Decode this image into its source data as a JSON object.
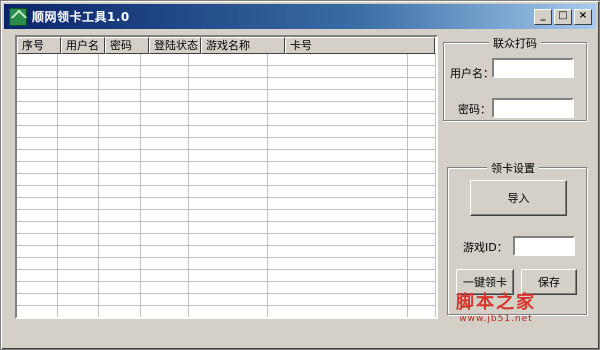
{
  "window": {
    "title": "顺网领卡工具1.0",
    "controls": [
      "_",
      "□",
      "×"
    ]
  },
  "list": {
    "columns": [
      "序号",
      "用户名",
      "密码",
      "登陆状态",
      "游戏名称",
      "卡号",
      ""
    ],
    "row_count": 24
  },
  "login_group": {
    "title": "联众打码",
    "username_label": "用户名：",
    "username_value": "",
    "password_label": "密码：",
    "password_value": ""
  },
  "card_group": {
    "title": "领卡设置",
    "import_button": "导入",
    "game_id_label": "游戏ID：",
    "game_id_value": "",
    "claim_button": "一键领卡",
    "save_button": "保存"
  },
  "watermark": {
    "main": "脚本之家",
    "sub": "www.jb51.net"
  }
}
